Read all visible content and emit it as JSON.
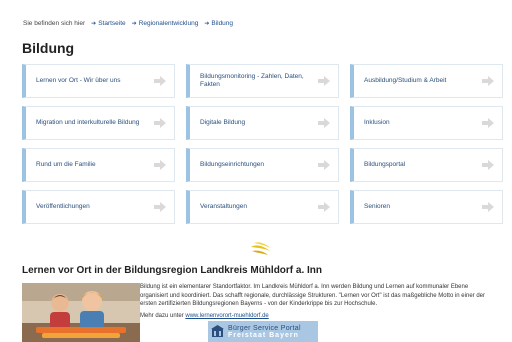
{
  "breadcrumb": {
    "intro": "Sie befinden sich hier",
    "items": [
      "Startseite",
      "Regionalentwicklung",
      "Bildung"
    ]
  },
  "page": {
    "title": "Bildung"
  },
  "tiles": [
    "Lernen vor Ort - Wir über uns",
    "Bildungsmonitoring - Zahlen, Daten, Fakten",
    "Ausbildung/Studium & Arbeit",
    "Migration und interkulturelle Bildung",
    "Digitale Bildung",
    "Inklusion",
    "Rund um die Familie",
    "Bildungseinrichtungen",
    "Bildungsportal",
    "Veröffentlichungen",
    "Veranstaltungen",
    "Senioren"
  ],
  "section": {
    "title": "Lernen vor Ort in der Bildungsregion Landkreis Mühldorf a. Inn",
    "paragraph1": "Bildung ist ein elementarer Standortfaktor. Im Landkreis Mühldorf a. Inn werden Bildung und Lernen auf kommunaler Ebene organisiert und koordiniert. Das schafft regionale, durchlässige Strukturen. \"Lernen vor Ort\" ist das maßgebliche Motto in einer der ersten zertifizierten Bildungsregionen Bayerns - von der Kinderkrippe bis zur Hochschule.",
    "more_prefix": "Mehr dazu unter",
    "more_link": "www.lernenvorort-muehldorf.de"
  },
  "banner": {
    "line1": "Bürger Service Portal",
    "line2": "Freistaat Bayern"
  },
  "colors": {
    "tile_border": "#9dc3e3",
    "link": "#1f4e8c",
    "logo": "#e8c21c"
  }
}
